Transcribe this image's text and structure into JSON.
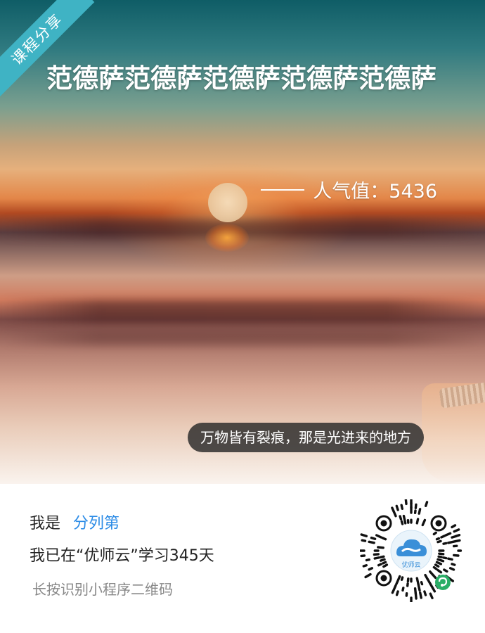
{
  "badge": "课程分享",
  "title": "范德萨范德萨范德萨范德萨范德萨",
  "popularity": "人气值：5436",
  "quote": "万物皆有裂痕，那是光进来的地方",
  "user": {
    "prefix": "我是",
    "name": "分列第"
  },
  "study_line": "我已在“优师云”学习345天",
  "hint": "长按识别小程序二维码",
  "qr": {
    "label": "优师云"
  },
  "colors": {
    "badge": "#3fb3c4",
    "name": "#2b8be6",
    "mini_program": "#2aae67"
  }
}
